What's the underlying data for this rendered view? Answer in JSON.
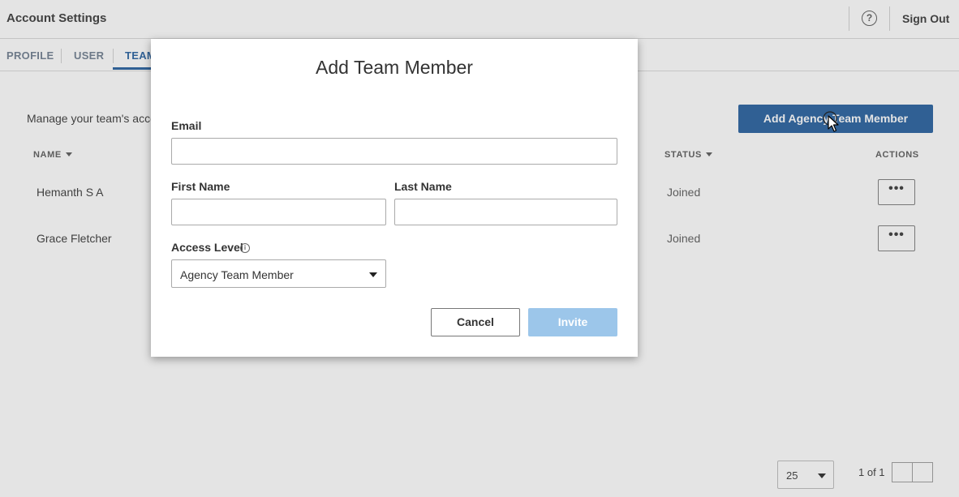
{
  "header": {
    "title": "Account Settings",
    "help_icon": "help-circle-icon",
    "sign_out": "Sign Out"
  },
  "tabs": [
    {
      "label": "PROFILE",
      "active": false
    },
    {
      "label": "USER",
      "active": false
    },
    {
      "label": "TEAM",
      "active": true
    }
  ],
  "main": {
    "description": "Manage your team's access",
    "add_button": "Add Agency Team Member",
    "columns": {
      "name": "NAME",
      "status": "STATUS",
      "actions": "ACTIONS"
    },
    "rows": [
      {
        "name": "Hemanth S A",
        "status": "Joined",
        "action": "•••"
      },
      {
        "name": "Grace Fletcher",
        "status": "Joined",
        "action": "•••"
      }
    ]
  },
  "pagination": {
    "page_size": "25",
    "page_info": "1 of 1"
  },
  "modal": {
    "title": "Add Team Member",
    "email_label": "Email",
    "email_value": "",
    "first_name_label": "First Name",
    "first_name_value": "",
    "last_name_label": "Last Name",
    "last_name_value": "",
    "access_level_label": "Access Level",
    "access_level_info_icon": "info-icon",
    "access_level_value": "Agency Team Member",
    "cancel": "Cancel",
    "invite": "Invite"
  },
  "colors": {
    "primary": "#1e5a9c",
    "primary_disabled": "#9cc6ea"
  }
}
